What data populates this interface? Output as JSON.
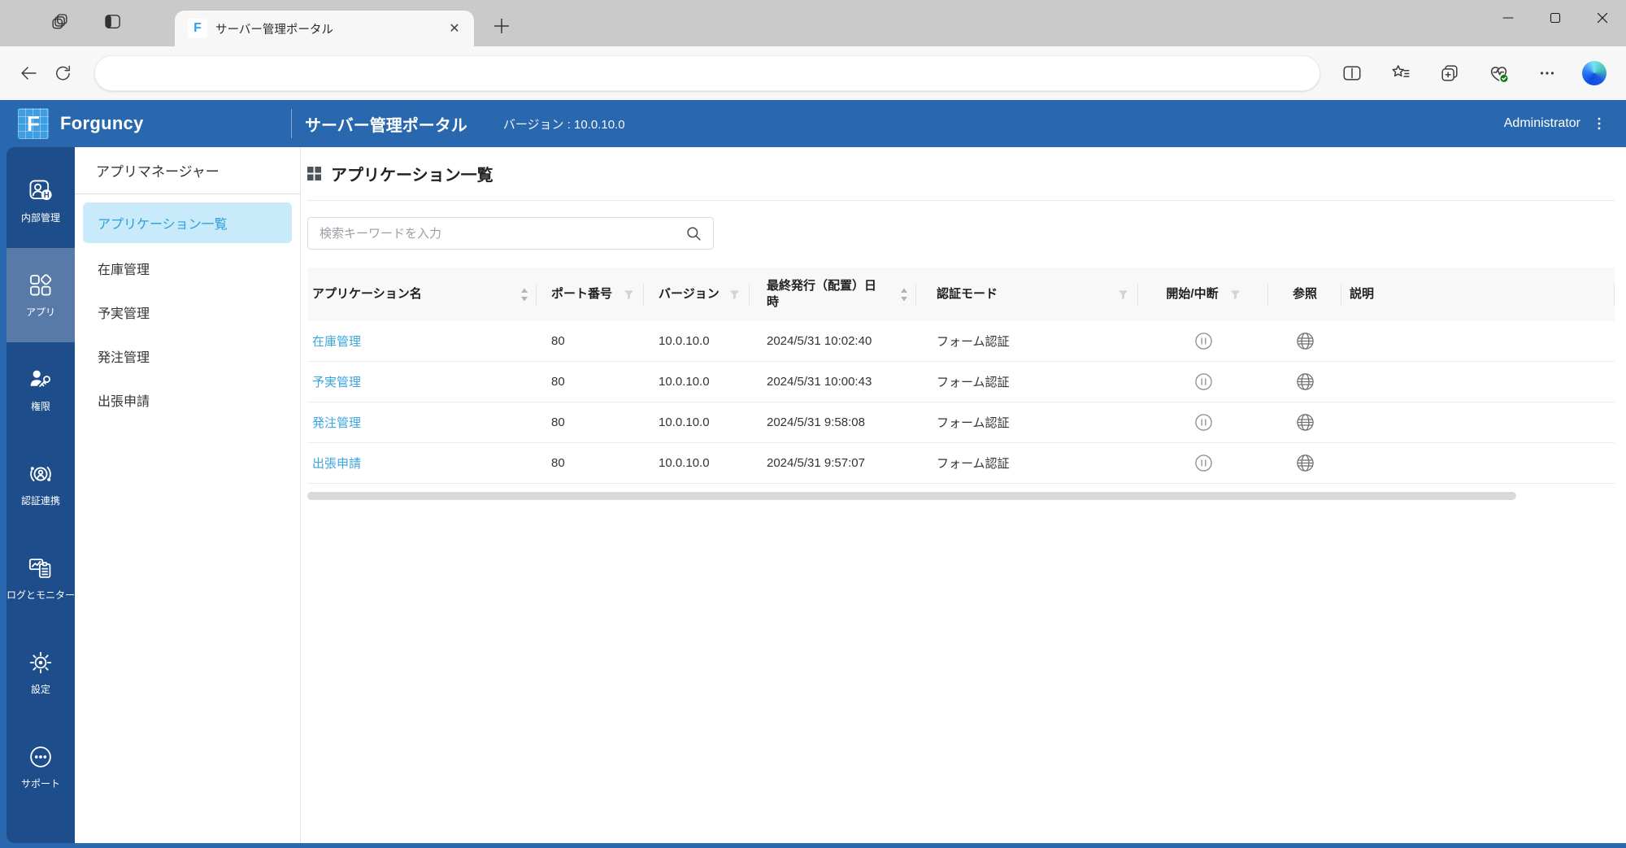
{
  "browser": {
    "tab_title": "サーバー管理ポータル",
    "address_value": "",
    "tabstrip_icons": [
      "tab-actions-icon",
      "workspaces-icon"
    ],
    "toolbar_icons": [
      "back-icon",
      "refresh-icon",
      "split-screen-icon",
      "favorites-icon",
      "collections-icon",
      "browser-essentials-icon",
      "ellipsis-icon",
      "copilot-icon"
    ],
    "window_controls": [
      "minimize",
      "maximize",
      "close"
    ]
  },
  "header": {
    "brand": "Forguncy",
    "title": "サーバー管理ポータル",
    "version": "バージョン : 10.0.10.0",
    "user": "Administrator"
  },
  "sidebar": {
    "items": [
      {
        "id": "internal-admin",
        "label": "内部管理",
        "icon": "internal-admin-icon",
        "selected": false
      },
      {
        "id": "apps",
        "label": "アプリ",
        "icon": "apps-icon",
        "selected": true
      },
      {
        "id": "permissions",
        "label": "権限",
        "icon": "permissions-icon",
        "selected": false
      },
      {
        "id": "auth-federation",
        "label": "認証連携",
        "icon": "auth-federation-icon",
        "selected": false
      },
      {
        "id": "logs-monitor",
        "label": "ログとモニター",
        "icon": "logs-monitor-icon",
        "selected": false
      },
      {
        "id": "settings",
        "label": "設定",
        "icon": "settings-icon",
        "selected": false
      },
      {
        "id": "support",
        "label": "サポート",
        "icon": "support-icon",
        "selected": false
      }
    ]
  },
  "submenu": {
    "title": "アプリマネージャー",
    "items": [
      {
        "id": "application-list",
        "label": "アプリケーション一覧",
        "selected": true
      },
      {
        "id": "inventory",
        "label": "在庫管理",
        "selected": false
      },
      {
        "id": "budget-actual",
        "label": "予実管理",
        "selected": false
      },
      {
        "id": "ordering",
        "label": "発注管理",
        "selected": false
      },
      {
        "id": "business-trip",
        "label": "出張申請",
        "selected": false
      }
    ]
  },
  "main": {
    "title": "アプリケーション一覧",
    "search_placeholder": "検索キーワードを入力",
    "table": {
      "columns": [
        {
          "label": "アプリケーション名",
          "control": "sort"
        },
        {
          "label": "ポート番号",
          "control": "filter"
        },
        {
          "label": "バージョン",
          "control": "filter"
        },
        {
          "label": "最終発行（配置）日時",
          "control": "sort"
        },
        {
          "label": "認証モード",
          "control": "filter"
        },
        {
          "label": "開始/中断",
          "control": "filter"
        },
        {
          "label": "参照",
          "control": "none"
        },
        {
          "label": "説明",
          "control": "none"
        }
      ],
      "rows": [
        {
          "name": "在庫管理",
          "port": "80",
          "version": "10.0.10.0",
          "published": "2024/5/31 10:02:40",
          "auth": "フォーム認証",
          "description": ""
        },
        {
          "name": "予実管理",
          "port": "80",
          "version": "10.0.10.0",
          "published": "2024/5/31 10:00:43",
          "auth": "フォーム認証",
          "description": ""
        },
        {
          "name": "発注管理",
          "port": "80",
          "version": "10.0.10.0",
          "published": "2024/5/31 9:58:08",
          "auth": "フォーム認証",
          "description": ""
        },
        {
          "name": "出張申請",
          "port": "80",
          "version": "10.0.10.0",
          "published": "2024/5/31 9:57:07",
          "auth": "フォーム認証",
          "description": ""
        }
      ]
    }
  },
  "colors": {
    "header_blue": "#2967ae",
    "rail_navy": "#1e4d8b",
    "rail_selected": "#587aa9",
    "submenu_sel_bg": "#c8eafa",
    "submenu_sel_text": "#2d9fd8",
    "link_blue": "#3aa6e0",
    "table_header_bg": "#f8f8f9"
  }
}
